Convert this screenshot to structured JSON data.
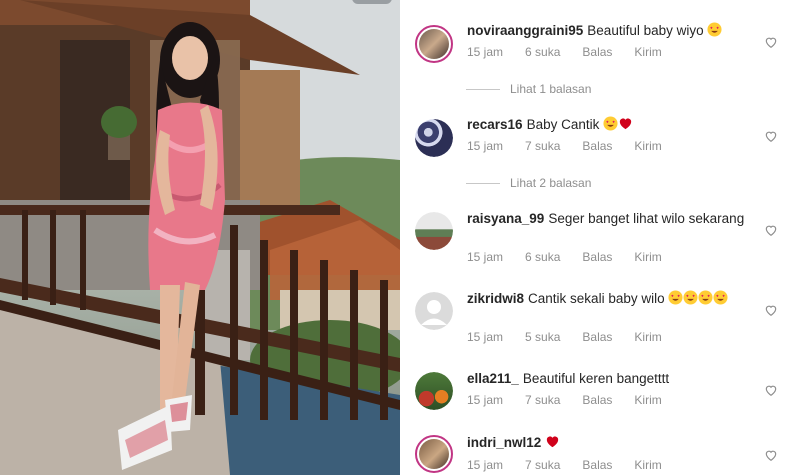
{
  "comments": [
    {
      "user": "noviraanggraini95",
      "text": "Beautiful baby wiyo",
      "emoji": [
        "heart-eyes"
      ],
      "time": "15 jam",
      "likes": "6 suka",
      "reply": "Balas",
      "send": "Kirim",
      "replies": "Lihat 1 balasan"
    },
    {
      "user": "recars16",
      "text": "Baby Cantik",
      "emoji": [
        "heart-eyes",
        "red-heart"
      ],
      "time": "15 jam",
      "likes": "7 suka",
      "reply": "Balas",
      "send": "Kirim",
      "replies": "Lihat 2 balasan"
    },
    {
      "user": "raisyana_99",
      "text": "Seger banget lihat wilo sekarang",
      "emoji": [],
      "time": "15 jam",
      "likes": "6 suka",
      "reply": "Balas",
      "send": "Kirim"
    },
    {
      "user": "zikridwi8",
      "text": "Cantik sekali baby wilo",
      "emoji": [
        "heart-eyes",
        "heart-eyes",
        "heart-eyes",
        "heart-eyes"
      ],
      "time": "15 jam",
      "likes": "5 suka",
      "reply": "Balas",
      "send": "Kirim"
    },
    {
      "user": "ella211_",
      "text": "Beautiful keren bangetttt",
      "emoji": [],
      "time": "15 jam",
      "likes": "7 suka",
      "reply": "Balas",
      "send": "Kirim"
    },
    {
      "user": "indri_nwl12",
      "text": "",
      "emoji": [
        "red-heart"
      ],
      "time": "15 jam",
      "likes": "7 suka",
      "reply": "Balas",
      "send": "Kirim"
    }
  ],
  "colors": {
    "text": "#262626",
    "muted": "#8e8e8e",
    "heart": "#ed4956",
    "ring": "#c13584"
  }
}
